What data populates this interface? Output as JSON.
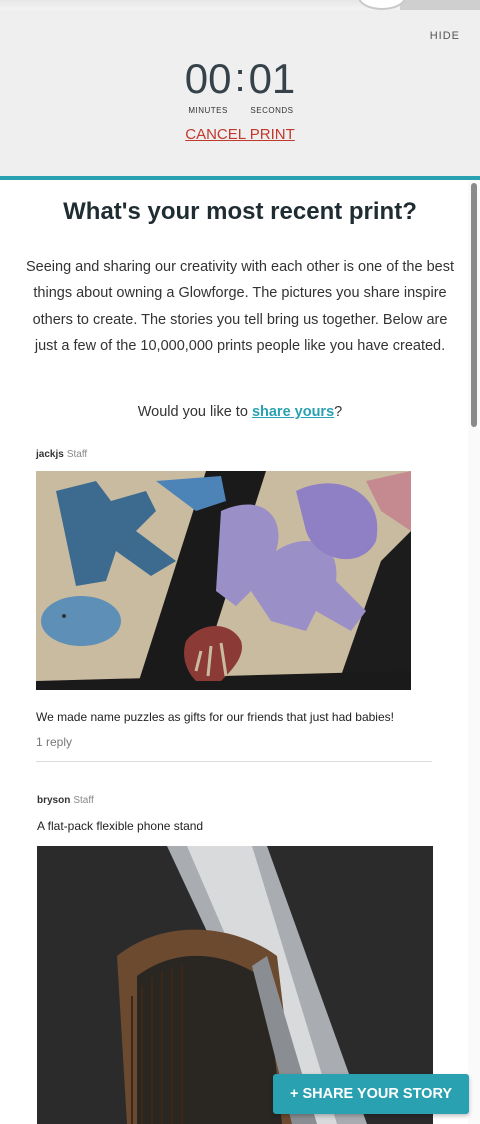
{
  "timer": {
    "hide_label": "HIDE",
    "minutes": "00",
    "seconds": "01",
    "separator": ":",
    "minutes_label": "MINUTES",
    "seconds_label": "SECONDS",
    "cancel_label": "CANCEL PRINT"
  },
  "main": {
    "heading": "What's your most recent print?",
    "intro": "Seeing and sharing our creativity with each other is one of the best things about owning a Glowforge. The pictures you share inspire others to create. The stories you tell bring us together. Below are just a few of the 10,000,000 prints people like you have created.",
    "share_prefix": "Would you like to ",
    "share_link": "share yours",
    "share_suffix": "?"
  },
  "posts": [
    {
      "author": "jackjs",
      "role": "Staff",
      "text": "We made name puzzles as gifts for our friends that just had babies!",
      "replies": "1 reply",
      "image": "wooden name puzzle with colored letters"
    },
    {
      "author": "bryson",
      "role": "Staff",
      "text": "A flat-pack flexible phone stand",
      "image": "wooden flexible phone stand holding a phone"
    }
  ],
  "cta": {
    "share_story_label": "+ SHARE YOUR STORY"
  },
  "colors": {
    "accent": "#2aa1b0",
    "cancel": "#c0392b",
    "heading": "#1f2d33",
    "panel": "#efefef"
  }
}
